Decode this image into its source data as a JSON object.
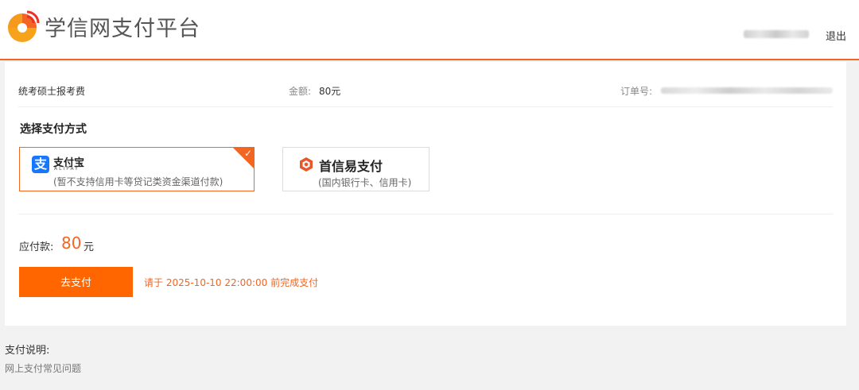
{
  "header": {
    "brand": "学信网支付平台",
    "logout": "退出",
    "brand_color": "#f26522"
  },
  "order": {
    "product": "统考硕士报考费",
    "amount_label": "金额:",
    "amount_value": "80元",
    "order_no_label": "订单号:"
  },
  "payment_methods": {
    "title": "选择支付方式",
    "alipay": {
      "name": "支付宝",
      "subname": "ALIPAY",
      "note": "(暂不支持信用卡等贷记类资金渠道付款)",
      "selected": true,
      "icon": "alipay-logo-icon"
    },
    "shouxin": {
      "name": "首信易支付",
      "note": "(国内银行卡、信用卡)",
      "selected": false,
      "icon": "shouxin-logo-icon"
    }
  },
  "due": {
    "label": "应付款:",
    "value": "80",
    "unit": "元"
  },
  "actions": {
    "pay_button": "去支付",
    "deadline": "请于 2025-10-10 22:00:00 前完成支付"
  },
  "help": {
    "title": "支付说明:",
    "link": "网上支付常见问题"
  }
}
